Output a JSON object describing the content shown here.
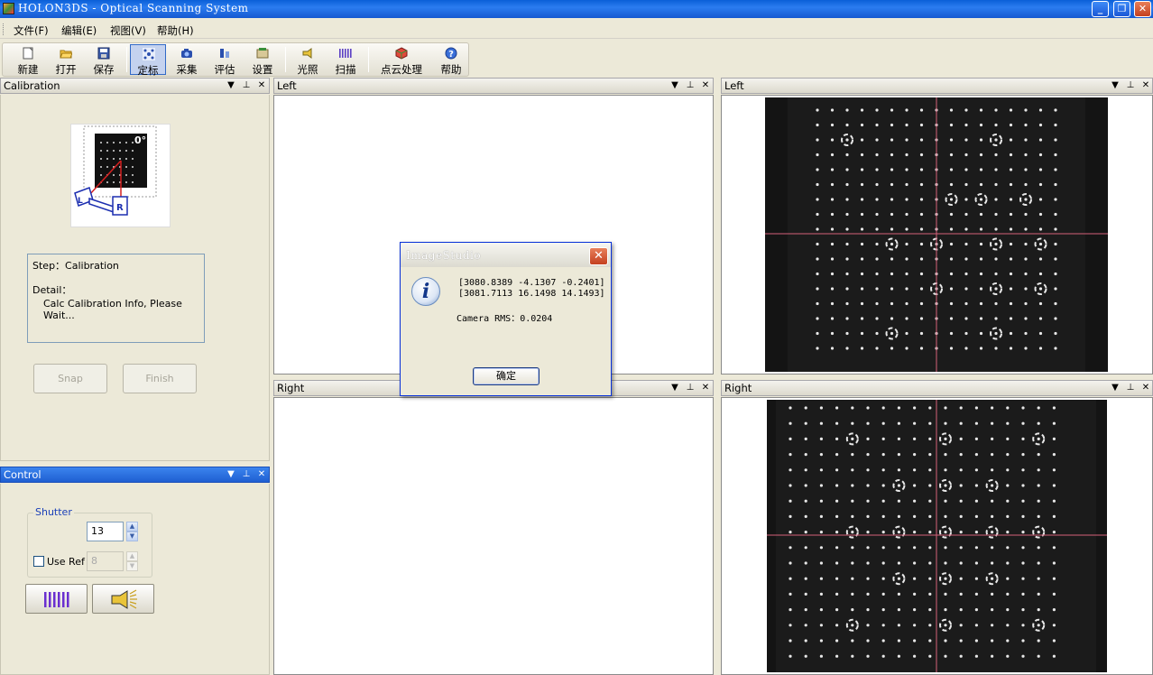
{
  "window": {
    "title": "HOLON3DS - Optical Scanning System"
  },
  "menu": [
    "文件(F)",
    "编辑(E)",
    "视图(V)",
    "帮助(H)"
  ],
  "toolbar": [
    {
      "label": "新建",
      "icon": "new-file-icon"
    },
    {
      "label": "打开",
      "icon": "open-folder-icon"
    },
    {
      "label": "保存",
      "icon": "save-disk-icon"
    },
    {
      "label": "定标",
      "icon": "calibration-icon",
      "active": true
    },
    {
      "label": "采集",
      "icon": "camera-capture-icon"
    },
    {
      "label": "评估",
      "icon": "evaluate-icon"
    },
    {
      "label": "设置",
      "icon": "settings-icon"
    },
    {
      "label": "光照",
      "icon": "light-icon"
    },
    {
      "label": "扫描",
      "icon": "scan-icon"
    },
    {
      "label": "点云处理",
      "icon": "point-cloud-icon"
    },
    {
      "label": "帮助",
      "icon": "help-icon"
    }
  ],
  "calibration_panel": {
    "title": "Calibration",
    "illustration": {
      "angle": "0°",
      "left_cam": "L",
      "right_cam": "R"
    },
    "step_label": "Step：Calibration",
    "detail_label": "Detail：",
    "detail_text": "Calc Calibration Info, Please Wait...",
    "snap_button": "Snap",
    "finish_button": "Finish"
  },
  "control_panel": {
    "title": "Control",
    "group_label": "Shutter",
    "shutter_value": "13",
    "use_ref_label": "Use Ref",
    "use_ref_checked": false,
    "ref_value": "8"
  },
  "views": {
    "left_top": "Left",
    "right_top": "Left",
    "left_bottom": "Right",
    "right_bottom": "Right"
  },
  "dialog": {
    "title": "ImageStudio",
    "line1": "[3080.8389 -4.1307 -0.2401]",
    "line2": "[3081.7113 16.1498 14.1493]",
    "rms": "Camera RMS：0.0204",
    "ok": "确定"
  },
  "colors": {
    "titlebar": "#0a5fd8",
    "panel_bg": "#ece9d8",
    "crosshair": "#d4607a",
    "active_header": "#3b84ee"
  }
}
